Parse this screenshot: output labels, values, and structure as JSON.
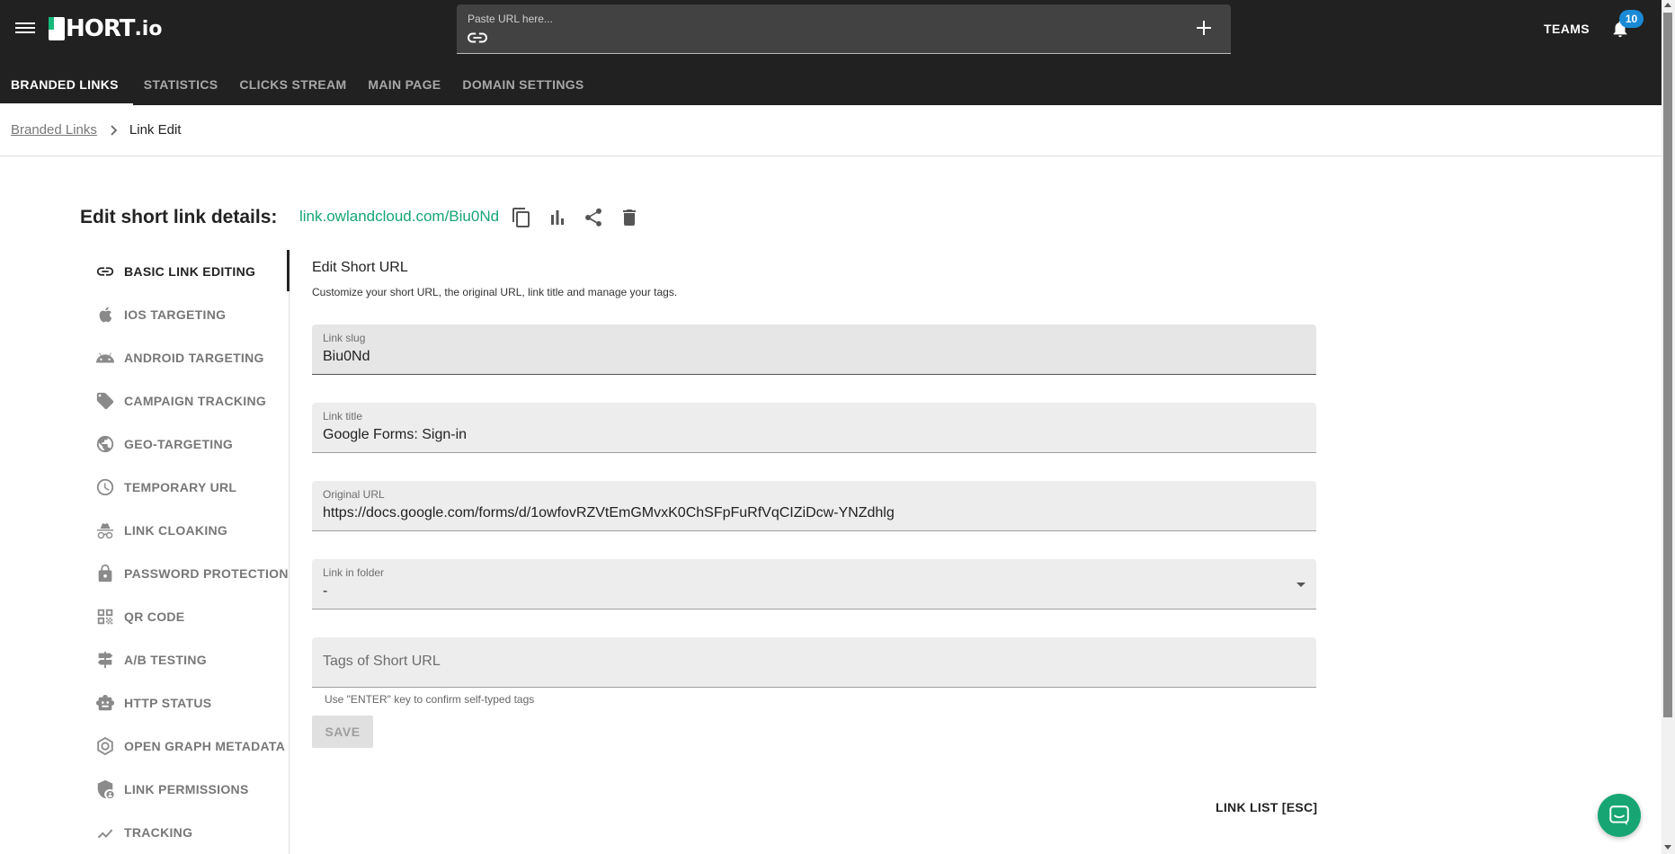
{
  "app": {
    "logo_text": "SHORT.io",
    "logo_main": "HORT",
    "logo_suffix": ".io"
  },
  "topbar": {
    "paste_label": "Paste URL here...",
    "teams_label": "TEAMS",
    "notifications_count": "10"
  },
  "tabs": [
    {
      "label": "BRANDED LINKS",
      "active": true
    },
    {
      "label": "STATISTICS",
      "active": false
    },
    {
      "label": "CLICKS STREAM",
      "active": false
    },
    {
      "label": "MAIN PAGE",
      "active": false
    },
    {
      "label": "DOMAIN SETTINGS",
      "active": false
    }
  ],
  "breadcrumb": {
    "parent": "Branded Links",
    "current": "Link Edit"
  },
  "header": {
    "title": "Edit short link details:",
    "short_link": "link.owlandcloud.com/Biu0Nd",
    "icons": [
      "copy-icon",
      "bar-chart-icon",
      "share-icon",
      "delete-icon"
    ]
  },
  "sidenav": [
    {
      "label": "BASIC LINK EDITING",
      "icon": "link-icon",
      "active": true
    },
    {
      "label": "IOS TARGETING",
      "icon": "apple-icon",
      "active": false
    },
    {
      "label": "ANDROID TARGETING",
      "icon": "android-icon",
      "active": false
    },
    {
      "label": "CAMPAIGN TRACKING",
      "icon": "tag-icon",
      "active": false
    },
    {
      "label": "GEO-TARGETING",
      "icon": "globe-icon",
      "active": false
    },
    {
      "label": "TEMPORARY URL",
      "icon": "clock-icon",
      "active": false
    },
    {
      "label": "LINK CLOAKING",
      "icon": "incognito-icon",
      "active": false
    },
    {
      "label": "PASSWORD PROTECTION",
      "icon": "lock-icon",
      "active": false
    },
    {
      "label": "QR CODE",
      "icon": "qr-code-icon",
      "active": false
    },
    {
      "label": "A/B TESTING",
      "icon": "signpost-icon",
      "active": false
    },
    {
      "label": "HTTP STATUS",
      "icon": "robot-icon",
      "active": false
    },
    {
      "label": "OPEN GRAPH METADATA",
      "icon": "graph-network-icon",
      "active": false
    },
    {
      "label": "LINK PERMISSIONS",
      "icon": "shield-user-icon",
      "active": false
    },
    {
      "label": "TRACKING",
      "icon": "trend-icon",
      "active": false
    }
  ],
  "form": {
    "title": "Edit Short URL",
    "subtitle": "Customize your short URL, the original URL, link title and manage your tags.",
    "slug": {
      "label": "Link slug",
      "value": "Biu0Nd"
    },
    "link_title": {
      "label": "Link title",
      "value": "Google Forms: Sign-in"
    },
    "original_url": {
      "label": "Original URL",
      "value": "https://docs.google.com/forms/d/1owfovRZVtEmGMvxK0ChSFpFuRfVqCIZiDcw-YNZdhlg"
    },
    "folder": {
      "label": "Link in folder",
      "value": "-"
    },
    "tags": {
      "placeholder": "Tags of Short URL"
    },
    "hint": "Use \"ENTER\" key to confirm self-typed tags",
    "save_label": "SAVE",
    "link_list_label": "LINK LIST [ESC]"
  },
  "colors": {
    "topbar_bg": "#212121",
    "accent_green": "#17a673",
    "badge_blue": "#1a8ad6"
  }
}
